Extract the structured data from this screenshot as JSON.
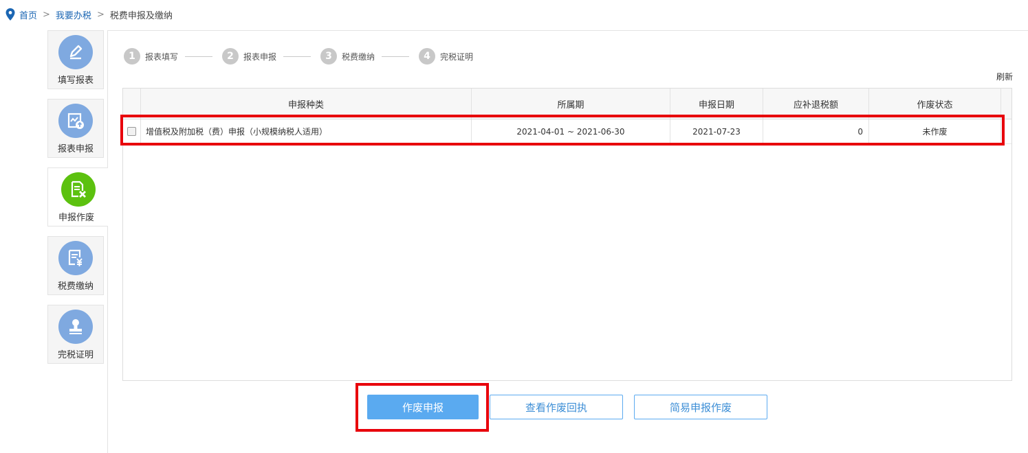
{
  "breadcrumb": {
    "home": "首页",
    "sep": ">",
    "tax": "我要办税",
    "current": "税费申报及缴纳"
  },
  "sidebar": {
    "items": [
      {
        "label": "填写报表",
        "icon": "pencil-icon"
      },
      {
        "label": "报表申报",
        "icon": "upload-report-icon"
      },
      {
        "label": "申报作废",
        "icon": "void-document-icon"
      },
      {
        "label": "税费缴纳",
        "icon": "tax-payment-icon"
      },
      {
        "label": "完税证明",
        "icon": "stamp-icon"
      }
    ],
    "active_index": 2
  },
  "steps": [
    {
      "num": "1",
      "label": "报表填写"
    },
    {
      "num": "2",
      "label": "报表申报"
    },
    {
      "num": "3",
      "label": "税费缴纳"
    },
    {
      "num": "4",
      "label": "完税证明"
    }
  ],
  "refresh_label": "刷新",
  "table": {
    "headers": [
      "申报种类",
      "所属期",
      "申报日期",
      "应补退税额",
      "作废状态"
    ],
    "rows": [
      {
        "type": "增值税及附加税（费）申报（小规模纳税人适用）",
        "period": "2021-04-01 ~ 2021-06-30",
        "date": "2021-07-23",
        "amount": "0",
        "status": "未作废"
      }
    ]
  },
  "buttons": {
    "void": "作废申报",
    "receipt": "查看作废回执",
    "simple": "简易申报作废"
  },
  "colors": {
    "link": "#1b66b3",
    "primary": "#5aaaf0",
    "highlight": "#e8000b",
    "active_circle": "#5cc10f",
    "inactive_circle": "#7fa9e0"
  }
}
